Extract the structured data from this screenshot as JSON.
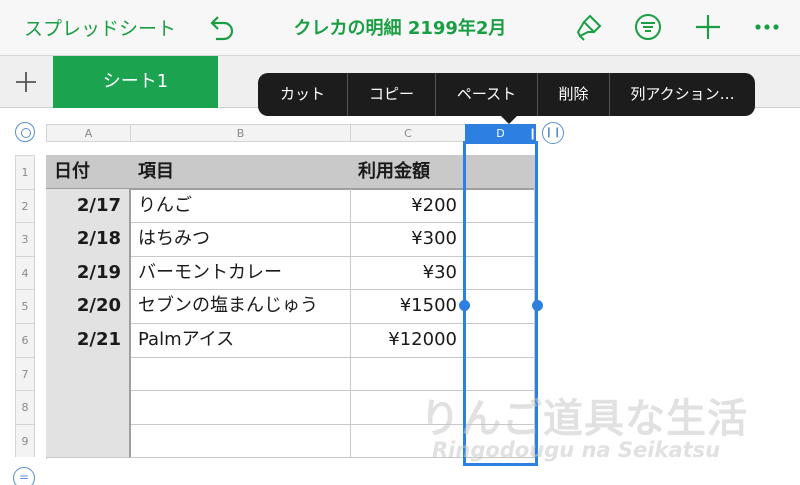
{
  "toolbar": {
    "back_label": "スプレッドシート",
    "title": "クレカの明細 2199年2月",
    "icons": [
      "undo-icon",
      "brush-icon",
      "filter-icon",
      "plus-icon",
      "more-icon"
    ]
  },
  "tabs": {
    "sheets": [
      "シート1"
    ]
  },
  "context_menu": {
    "items": [
      "カット",
      "コピー",
      "ペースト",
      "削除",
      "列アクション…"
    ]
  },
  "sheet": {
    "column_headers": [
      "A",
      "B",
      "C",
      "D"
    ],
    "selected_column": "D",
    "row_numbers": [
      "1",
      "2",
      "3",
      "4",
      "5",
      "6",
      "7",
      "8",
      "9"
    ],
    "header_row": [
      "日付",
      "項目",
      "利用金額",
      ""
    ],
    "rows": [
      [
        "2/17",
        "りんご",
        "¥200",
        ""
      ],
      [
        "2/18",
        "はちみつ",
        "¥300",
        ""
      ],
      [
        "2/19",
        "バーモントカレー",
        "¥30",
        ""
      ],
      [
        "2/20",
        "セブンの塩まんじゅう",
        "¥1500",
        ""
      ],
      [
        "2/21",
        "Palmアイス",
        "¥12000",
        ""
      ],
      [
        "",
        "",
        "",
        ""
      ],
      [
        "",
        "",
        "",
        ""
      ],
      [
        "",
        "",
        "",
        ""
      ]
    ]
  },
  "watermark": {
    "jp": "りんご道具な生活",
    "en": "Ringodougu na Seikatsu"
  },
  "colors": {
    "accent_green": "#1a9e43",
    "tab_green": "#1ca34f",
    "selection_blue": "#2d7fe1",
    "menu_bg": "#1c1c1c"
  }
}
